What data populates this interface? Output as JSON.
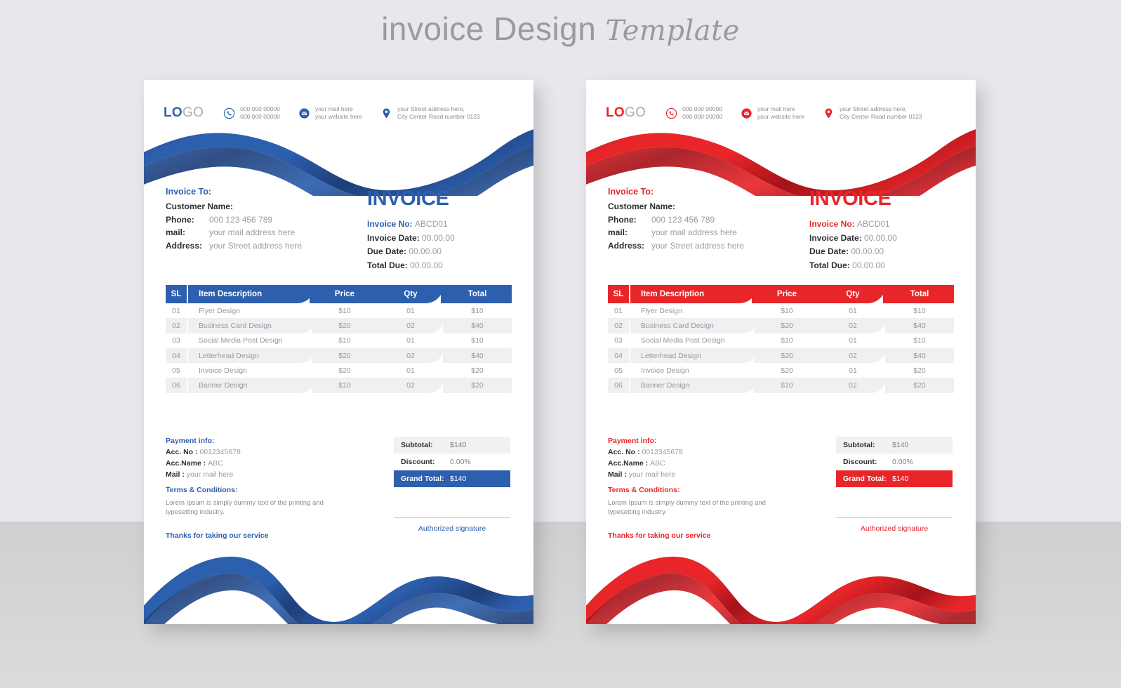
{
  "page": {
    "title_main": "invoice Design",
    "title_script": "Template"
  },
  "theme": {
    "blue": "#2c5fae",
    "blue_dark": "#1e3f7a",
    "red": "#e8262a",
    "red_dark": "#a4131a",
    "gray_text": "#9b9ca2",
    "row_alt": "#f0f0f2"
  },
  "invoice": {
    "logo_bold": "LO",
    "logo_light": "GO",
    "contacts": [
      {
        "icon": "phone-icon",
        "line1": "000 000 00000",
        "line2": "000 000 00000"
      },
      {
        "icon": "mail-icon",
        "line1": "your mail here",
        "line2": "your website here"
      },
      {
        "icon": "location-icon",
        "line1": "your Street address here,",
        "line2": "City Center Road number 0123"
      }
    ],
    "invoice_to_heading": "Invoice To:",
    "bill_to": [
      {
        "label": "Customer Name:",
        "value": ""
      },
      {
        "label": "Phone:",
        "value": "000 123 456 789"
      },
      {
        "label": "mail:",
        "value": "your mail address here"
      },
      {
        "label": "Address:",
        "value": "your Street address here"
      }
    ],
    "title": "INVOICE",
    "meta": [
      {
        "label": "Invoice No:",
        "value": "ABCD01",
        "accent": true
      },
      {
        "label": "Invoice Date:",
        "value": "00.00.00",
        "accent": false
      },
      {
        "label": "Due Date:",
        "value": "00.00.00",
        "accent": false
      },
      {
        "label": "Total Due:",
        "value": "00.00.00",
        "accent": false
      }
    ],
    "table": {
      "headers": [
        "SL",
        "Item Description",
        "Price",
        "Qty",
        "Total"
      ],
      "rows": [
        {
          "sl": "01",
          "desc": "Flyer Design",
          "price": "$10",
          "qty": "01",
          "total": "$10"
        },
        {
          "sl": "02",
          "desc": "Business Card Design",
          "price": "$20",
          "qty": "02",
          "total": "$40"
        },
        {
          "sl": "03",
          "desc": "Social Media Post Design",
          "price": "$10",
          "qty": "01",
          "total": "$10"
        },
        {
          "sl": "04",
          "desc": "Letterhead Design",
          "price": "$20",
          "qty": "02",
          "total": "$40"
        },
        {
          "sl": "05",
          "desc": "Invoice Design",
          "price": "$20",
          "qty": "01",
          "total": "$20"
        },
        {
          "sl": "06",
          "desc": "Banner Design",
          "price": "$10",
          "qty": "02",
          "total": "$20"
        }
      ]
    },
    "payment_heading": "Payment info:",
    "payment": [
      {
        "label": "Acc. No :",
        "value": "0012345678"
      },
      {
        "label": "Acc.Name :",
        "value": "ABC"
      },
      {
        "label": "Mail :",
        "value": "your mail here"
      }
    ],
    "terms_heading": "Terms & Conditions:",
    "terms_body": "Lorem Ipsum is simply dummy text of the printing and typesetting industry.",
    "thanks": "Thanks for taking our service",
    "totals": [
      {
        "label": "Subtotal:",
        "value": "$140",
        "style": "sub"
      },
      {
        "label": "Discount:",
        "value": "0.00%",
        "style": "dis"
      },
      {
        "label": "Grand Total:",
        "value": "$140",
        "style": "grand"
      }
    ],
    "signature_label": "Authorized signature"
  }
}
